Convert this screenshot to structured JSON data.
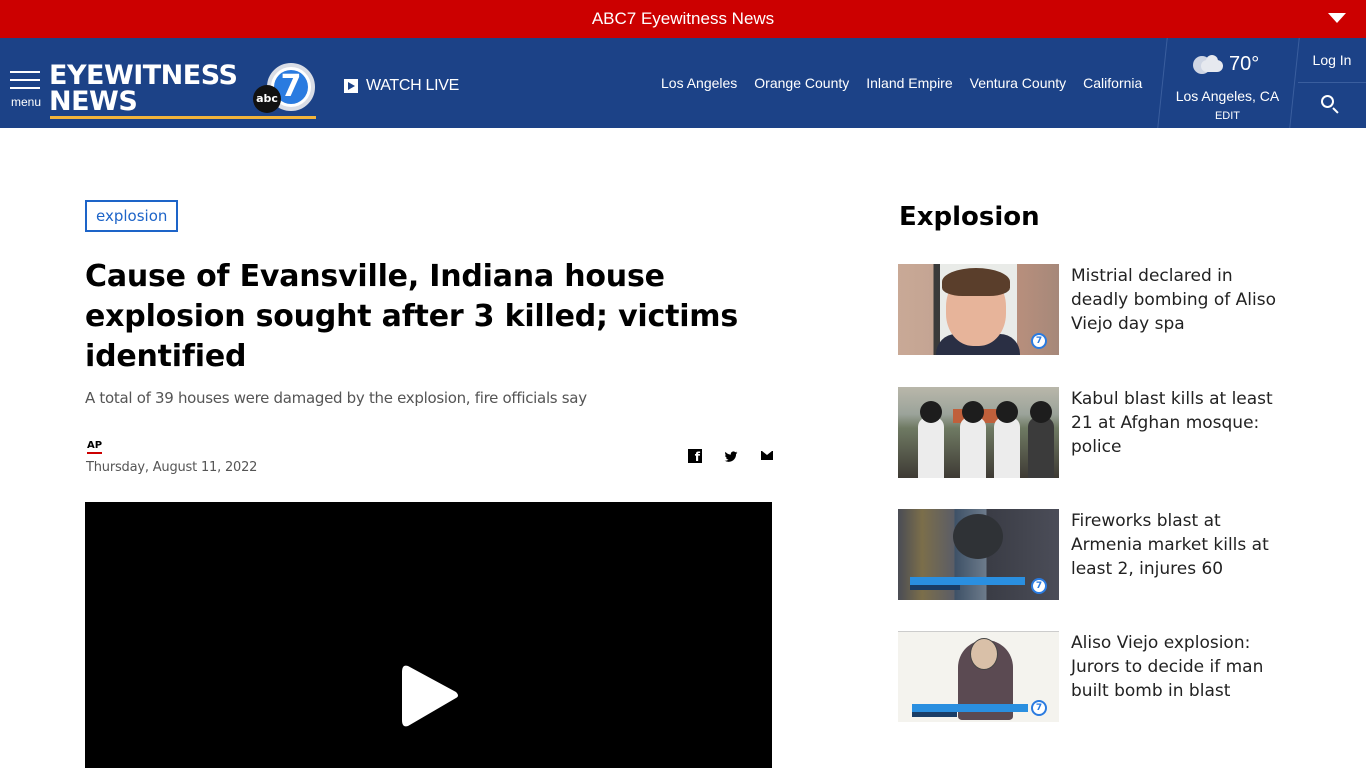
{
  "topbar": {
    "title": "ABC7 Eyewitness News",
    "dropdown_icon": "caret-down-icon"
  },
  "navbar": {
    "menu_label": "menu",
    "logo": {
      "line1": "EYEWITNESS",
      "line2": "NEWS",
      "network": "abc",
      "channel": "7"
    },
    "watch_live": "WATCH LIVE",
    "regions": [
      "Los Angeles",
      "Orange County",
      "Inland Empire",
      "Ventura County",
      "California"
    ],
    "weather": {
      "icon": "partly-cloudy-night-icon",
      "temperature": "70°",
      "location": "Los Angeles, CA",
      "edit_label": "EDIT"
    },
    "login_label": "Log In",
    "search_icon": "search-icon"
  },
  "article": {
    "tag": "explosion",
    "headline": "Cause of Evansville, Indiana house explosion sought after 3 killed; victims identified",
    "subheadline": "A total of 39 houses were damaged by the explosion, fire officials say",
    "source": "AP",
    "date": "Thursday, August 11, 2022",
    "share": [
      "facebook",
      "twitter",
      "email"
    ],
    "facebook_glyph": "f"
  },
  "sidebar": {
    "title": "Explosion",
    "stories": [
      {
        "title": "Mistrial declared in deadly bombing of Aliso Viejo day spa"
      },
      {
        "title": "Kabul blast kills at least 21 at Afghan mosque: police"
      },
      {
        "title": "Fireworks blast at Armenia market kills at least 2, injures 60"
      },
      {
        "title": "Aliso Viejo explosion: Jurors to decide if man built bomb in blast"
      }
    ]
  },
  "colors": {
    "alert_red": "#cc0000",
    "nav_blue": "#1c4287",
    "tag_blue": "#1d64c8",
    "logo_gold": "#f2b43b"
  }
}
